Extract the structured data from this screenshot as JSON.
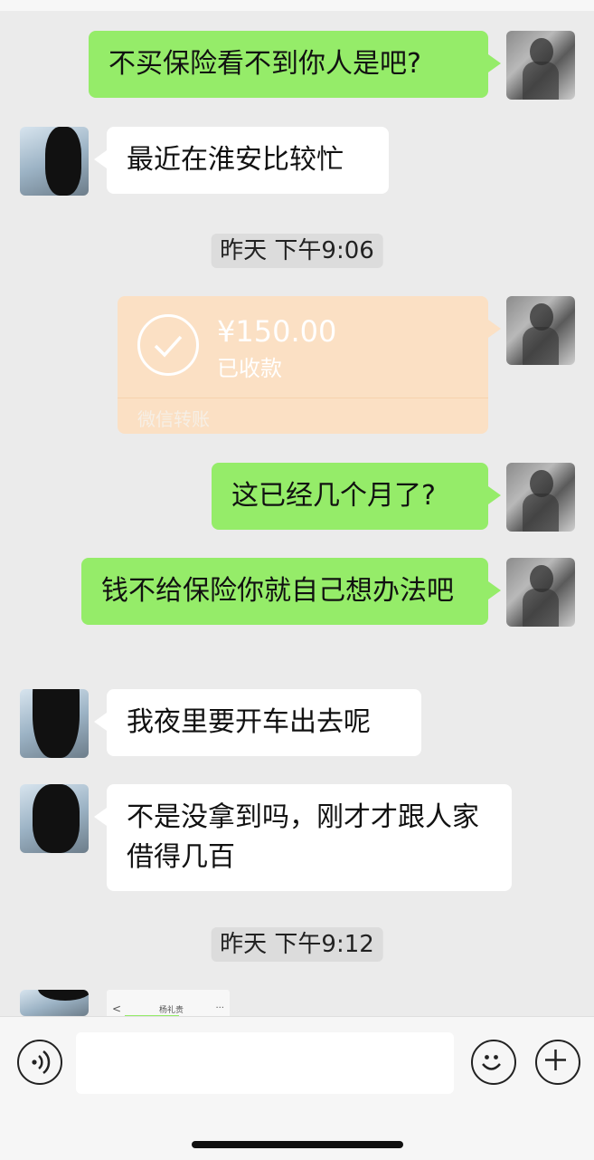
{
  "messages": [
    {
      "text": "不买保险看不到你人是吧?"
    },
    {
      "text": "最近在淮安比较忙"
    },
    {
      "text": "这已经几个月了?"
    },
    {
      "text": "钱不给保险你就自己想办法吧"
    },
    {
      "text": "我夜里要开车出去呢"
    },
    {
      "text": "不是没拿到吗，刚才才跟人家借得几百"
    }
  ],
  "timestamps": [
    "昨天 下午9:06",
    "昨天 下午9:12"
  ],
  "transfer": {
    "amount": "¥150.00",
    "status": "已收款",
    "label": "微信转账"
  },
  "screenshot_thumb": {
    "back": "<",
    "title": "杨礼贵",
    "more": "..."
  },
  "input": {
    "placeholder": ""
  },
  "colors": {
    "self_bubble": "#95ec69",
    "other_bubble": "#ffffff",
    "transfer": "#fbe0c4",
    "background": "#ebebeb"
  },
  "icons": [
    "voice-icon",
    "emoji-icon",
    "plus-icon",
    "check-circle-icon"
  ]
}
